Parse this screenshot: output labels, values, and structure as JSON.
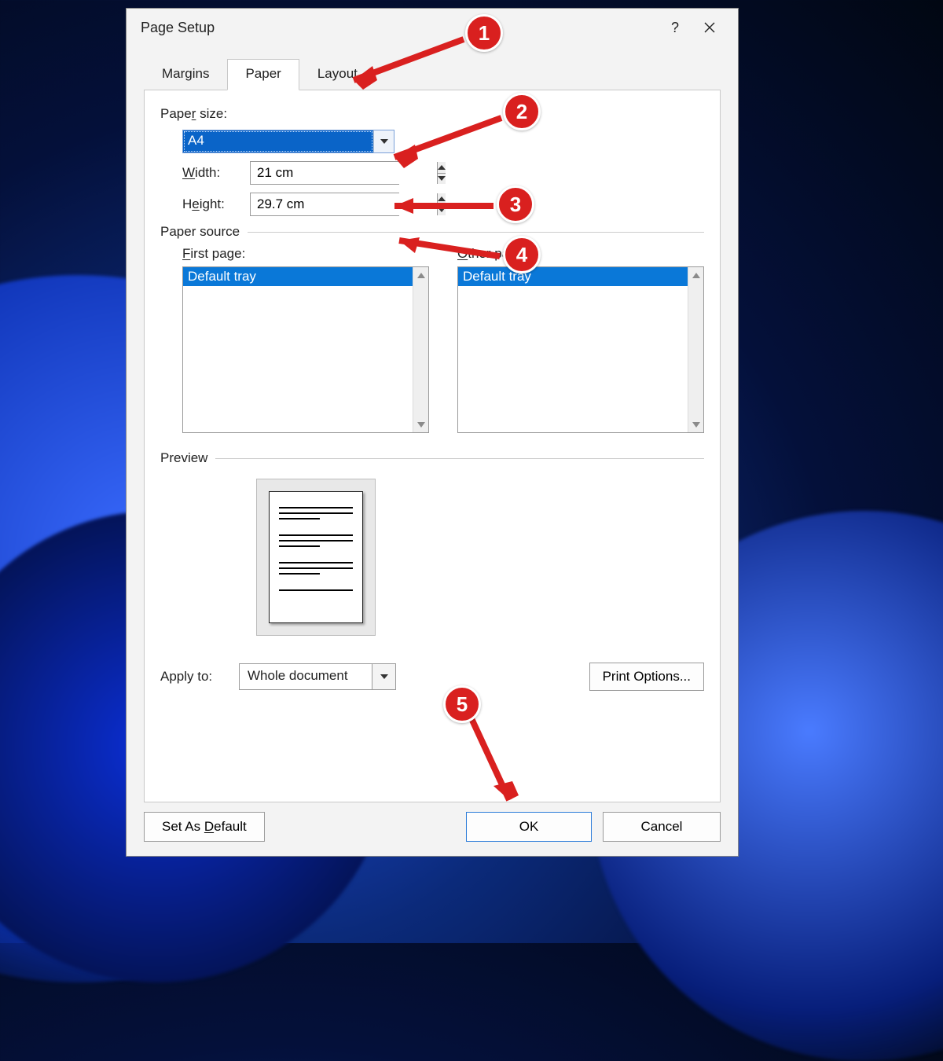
{
  "dialog": {
    "title": "Page Setup",
    "help": "?",
    "tabs": {
      "margins": "Margins",
      "paper": "Paper",
      "layout": "Layout"
    },
    "paper_size": {
      "label_html": [
        "Pape",
        "r",
        " size:"
      ],
      "value": "A4"
    },
    "width": {
      "label_html": [
        "W",
        "idth:"
      ],
      "value": "21 cm"
    },
    "height": {
      "label_html": [
        "H",
        "e",
        "ight:"
      ],
      "value": "29.7 cm"
    },
    "paper_source_label": "Paper source",
    "first_page": {
      "label_html": [
        "F",
        "irst page:"
      ],
      "selected": "Default tray"
    },
    "other_pages": {
      "label_html": [
        "O",
        "ther pages:"
      ],
      "selected": "Default tray"
    },
    "preview_label": "Preview",
    "apply_to": {
      "label": "Apply to:",
      "value": "Whole document"
    },
    "print_options": "Print Options...",
    "set_default": [
      "Set As ",
      "D",
      "efault"
    ],
    "ok": "OK",
    "cancel": "Cancel"
  },
  "annotations": {
    "1": "1",
    "2": "2",
    "3": "3",
    "4": "4",
    "5": "5"
  }
}
